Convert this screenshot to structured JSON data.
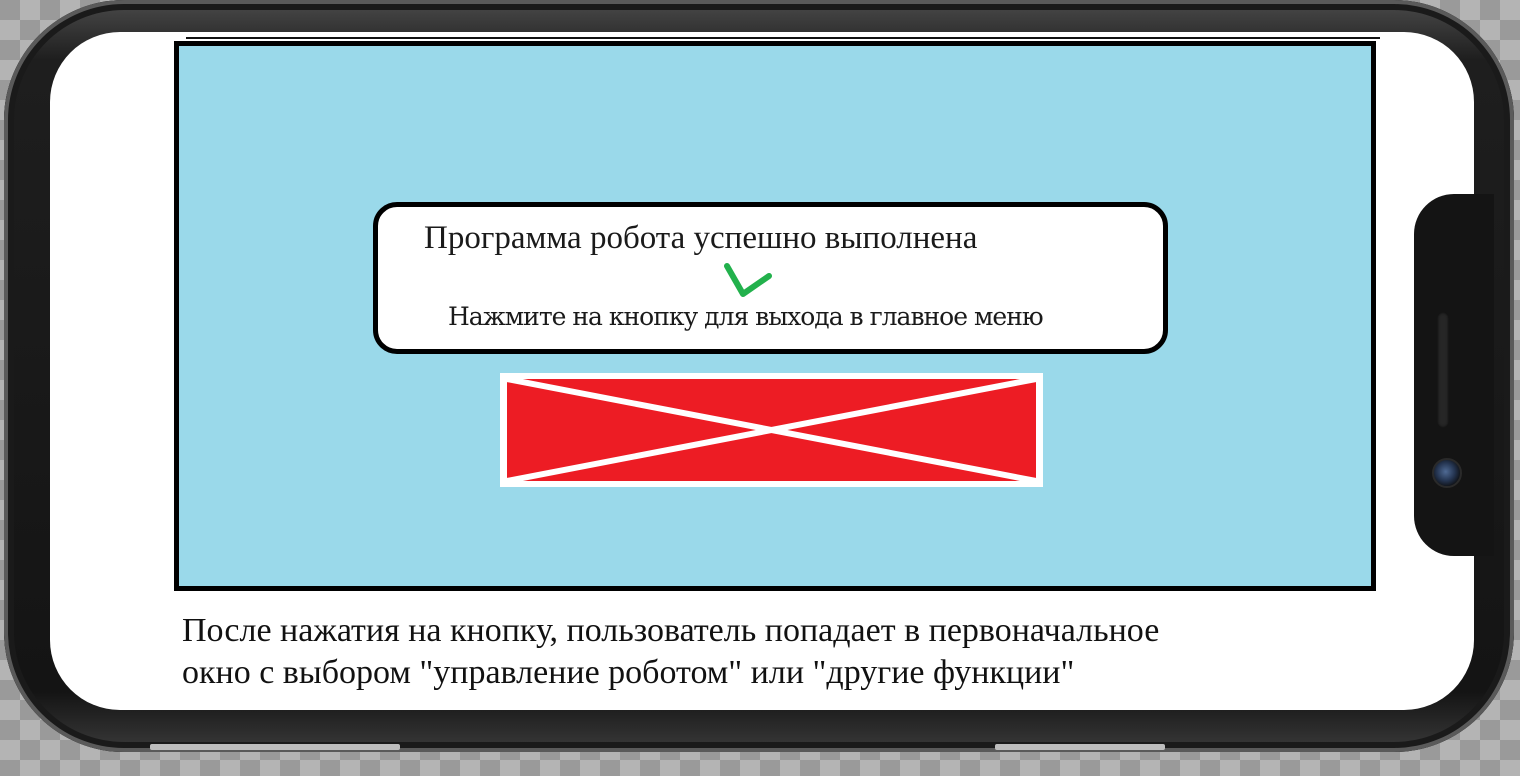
{
  "dialog": {
    "title": "Программа робота успешно выполнена",
    "subtitle": "Нажмите на кнопку для выхода в главное меню",
    "success_icon": "checkmark-icon"
  },
  "exit_button": {
    "icon": "cross-icon"
  },
  "caption": {
    "line1": "После нажатия на кнопку, пользователь попадает в первоначальное",
    "line2": "окно с выбором \"управление роботом\" или \"другие функции\""
  },
  "colors": {
    "app_background": "#9ad9ea",
    "exit_button": "#ed1c24",
    "checkmark": "#22b14c"
  }
}
